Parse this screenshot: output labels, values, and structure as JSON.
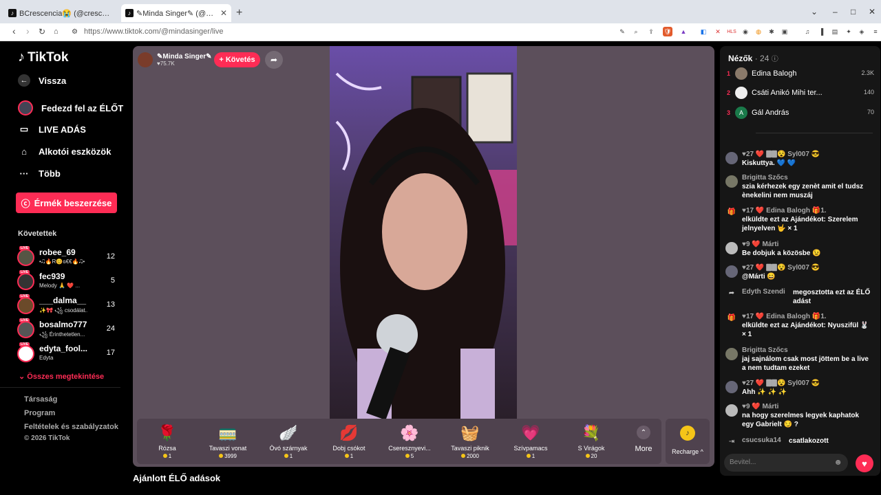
{
  "browser": {
    "tabs": [
      {
        "title": "BCrescencia😭 (@crescencia.27) ..."
      },
      {
        "title": "✎Minda Singer✎ (@mindasinger) ...",
        "close": "✕"
      }
    ],
    "new_tab": "+",
    "url": "https://www.tiktok.com/@mindasinger/live"
  },
  "sidebar": {
    "logo": "TikTok",
    "back": "Vissza",
    "nav": [
      {
        "label": "Fedezd fel az ÉLŐT",
        "icon": "live-avatar-icon"
      },
      {
        "label": "LIVE ADÁS",
        "icon": "video-camera-icon"
      },
      {
        "label": "Alkotói eszközök",
        "icon": "house-icon"
      },
      {
        "label": "Több",
        "icon": "ellipsis-icon"
      }
    ],
    "coin_button": "Érmék beszerzése",
    "following_title": "Követettek",
    "following": [
      {
        "name": "robee_69",
        "sub": "•🎝🔥R😊ɢ€€🔥🎝•",
        "count": "12"
      },
      {
        "name": "fec939",
        "sub": "Melody 🙏 ❤️ ...",
        "count": "5"
      },
      {
        "name": "___dalma__",
        "sub": "✨🎀 ꧁ csodálat...",
        "count": "13"
      },
      {
        "name": "bosalmo777",
        "sub": "꧁ Érinthetetlen...",
        "count": "24"
      },
      {
        "name": "edyta_fool...",
        "sub": "Edyta",
        "count": "17"
      }
    ],
    "see_all": "Összes megtekintése",
    "footer": [
      "Társaság",
      "Program",
      "Feltételek és szabályzatok",
      "© 2026 TikTok"
    ]
  },
  "stage": {
    "host_name": "✎Minda Singer✎",
    "host_likes": "♥75.7K",
    "follow_button": "+ Követés",
    "gifts": [
      {
        "name": "Rózsa",
        "price": "1",
        "icon": "🌹"
      },
      {
        "name": "Tavaszi vonat",
        "price": "3999",
        "icon": "🚃"
      },
      {
        "name": "Óvó szárnyak",
        "price": "1",
        "icon": "🪽"
      },
      {
        "name": "Dobj csókot",
        "price": "1",
        "icon": "💋"
      },
      {
        "name": "Cseresznyevi...",
        "price": "5",
        "icon": "🌸"
      },
      {
        "name": "Tavaszi piknik",
        "price": "2000",
        "icon": "🧺"
      },
      {
        "name": "Szívpamacs",
        "price": "1",
        "icon": "💗"
      },
      {
        "name": "S Virágok",
        "price": "20",
        "icon": "💐"
      }
    ],
    "more_label": "More",
    "recharge_label": "Recharge ^",
    "below_title": "Ajánlott ÉLŐ adások"
  },
  "viewers": {
    "title": "Nézők",
    "count": "· 24",
    "ranks": [
      {
        "n": "1",
        "name": "Edina Balogh",
        "value": "2.3K"
      },
      {
        "n": "2",
        "name": "Csáti Anikó Mihi ter...",
        "value": "140"
      },
      {
        "n": "3",
        "name": "Gál András",
        "value": "70"
      }
    ]
  },
  "chat": [
    {
      "header": "♥27 ❤️ 🀫🀫😵 Syl007 😎",
      "text": "Kiskuttya. 💙 💙"
    },
    {
      "header": "Brigitta Szőcs",
      "text": "szia kérhezek egy zenèt amit el tudsz ènekelini nem muszáj"
    },
    {
      "header": "♥17 ❤️ Edina Balogh 🎁1.",
      "text": "elküldte ezt az Ajándékot: Szerelem jelnyelven 🤟 × 1"
    },
    {
      "header": "♥9 ❤️ Márti",
      "text": "Be dobjuk a közösbe 😉"
    },
    {
      "header": "♥27 ❤️ 🀫🀫😵 Syl007 😎",
      "text": "@Márti 😄"
    },
    {
      "header": "Edyth Szendi",
      "text": "megosztotta ezt az ÉLŐ adást"
    },
    {
      "header": "♥17 ❤️ Edina Balogh 🎁1.",
      "text": "elküldte ezt az Ajándékot: Nyuszifül 🐰 × 1"
    },
    {
      "header": "Brigitta Szőcs",
      "text": "jaj sajnálom csak most jöttem be a live a nem tudtam ezeket"
    },
    {
      "header": "♥27 ❤️ 🀫🀫😵 Syl007 😎",
      "text": "Ahh ✨ ✨ ✨"
    },
    {
      "header": "♥9 ❤️ Márti",
      "text": "na hogy szerelmes legyek kaphatok egy Gabrielt 😏 ?"
    },
    {
      "header": "csucsuka14",
      "text": "csatlakozott"
    }
  ],
  "chat_input_placeholder": "Bevitel..."
}
